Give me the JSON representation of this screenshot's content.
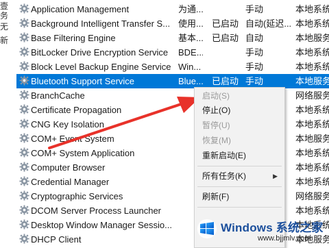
{
  "left_pane": {
    "chars": [
      "壹",
      "务",
      "无",
      "新"
    ]
  },
  "services": [
    {
      "name": "Application Management",
      "desc": "为通...",
      "status": "",
      "startup": "手动",
      "logon": "本地系统"
    },
    {
      "name": "Background Intelligent Transfer S...",
      "desc": "使用...",
      "status": "已启动",
      "startup": "自动(延迟...",
      "logon": "本地系统"
    },
    {
      "name": "Base Filtering Engine",
      "desc": "基本...",
      "status": "已启动",
      "startup": "自动",
      "logon": "本地服务"
    },
    {
      "name": "BitLocker Drive Encryption Service",
      "desc": "BDE...",
      "status": "",
      "startup": "手动",
      "logon": "本地系统"
    },
    {
      "name": "Block Level Backup Engine Service",
      "desc": "Win...",
      "status": "",
      "startup": "手动",
      "logon": "本地系统"
    },
    {
      "name": "Bluetooth Support Service",
      "desc": "Blue...",
      "status": "已启动",
      "startup": "手动",
      "logon": "本地服务"
    },
    {
      "name": "BranchCache",
      "desc": "",
      "status": "",
      "startup": "",
      "logon": "网络服务"
    },
    {
      "name": "Certificate Propagation",
      "desc": "",
      "status": "",
      "startup": "",
      "logon": "本地系统"
    },
    {
      "name": "CNG Key Isolation",
      "desc": "",
      "status": "",
      "startup": "",
      "logon": "本地系统"
    },
    {
      "name": "COM+ Event System",
      "desc": "",
      "status": "",
      "startup": "",
      "logon": "本地服务"
    },
    {
      "name": "COM+ System Application",
      "desc": "",
      "status": "",
      "startup": "",
      "logon": "本地系统"
    },
    {
      "name": "Computer Browser",
      "desc": "",
      "status": "",
      "startup": "",
      "logon": "本地系统"
    },
    {
      "name": "Credential Manager",
      "desc": "",
      "status": "",
      "startup": "",
      "logon": "本地系统"
    },
    {
      "name": "Cryptographic Services",
      "desc": "",
      "status": "",
      "startup": "",
      "logon": "网络服务"
    },
    {
      "name": "DCOM Server Process Launcher",
      "desc": "",
      "status": "",
      "startup": "",
      "logon": "本地系统"
    },
    {
      "name": "Desktop Window Manager Sessio...",
      "desc": "",
      "status": "",
      "startup": "",
      "logon": "本地系统"
    },
    {
      "name": "DHCP Client",
      "desc": "",
      "status": "",
      "startup": "",
      "logon": "本地服务"
    }
  ],
  "selected_index": 5,
  "context_menu": {
    "start": "启动(S)",
    "stop": "停止(O)",
    "pause": "暂停(U)",
    "resume": "恢复(M)",
    "restart": "重新启动(E)",
    "all_tasks": "所有任务(K)",
    "refresh": "刷新(F)"
  },
  "watermark": {
    "brand": "Windows",
    "tagline": "系统之家",
    "url": "www.bjjmlv.com"
  },
  "colors": {
    "selection": "#0078d7",
    "arrow": "#e8322a",
    "menu_bg": "#f2f2f2"
  }
}
